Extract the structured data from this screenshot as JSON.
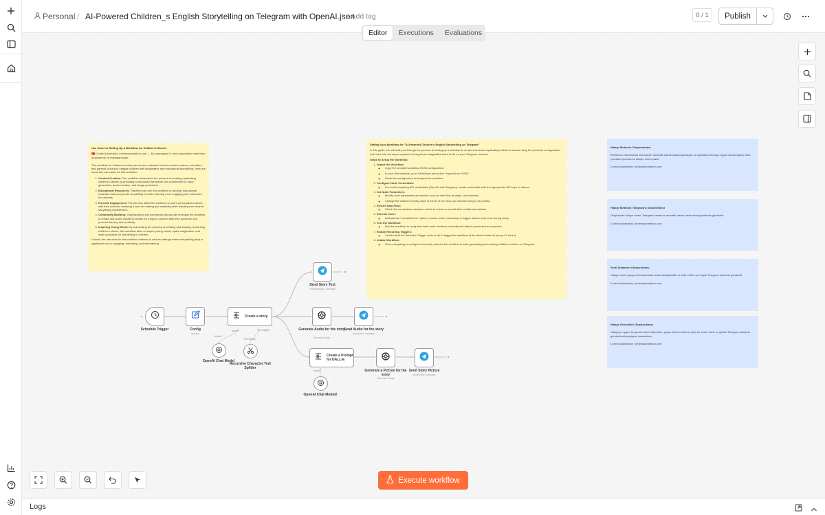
{
  "sidebar": {
    "items": [
      "add-icon",
      "search-icon",
      "panel-icon",
      "home-icon",
      "chart-icon",
      "help-icon",
      "settings-icon"
    ]
  },
  "header": {
    "project": "Personal",
    "separator": "/",
    "title": "AI-Powered Children_s English Storytelling on Telegram with OpenAI.json",
    "add_tag": "+ Add tag",
    "counter": "0 / 1",
    "publish": "Publish"
  },
  "tabs": {
    "editor": "Editor",
    "executions": "Executions",
    "evaluations": "Evaluations"
  },
  "notes": {
    "use_case": {
      "title": "Use Case for Setting Up a Workflow for Children's Stories",
      "brand_line": "🇹🇷 D-mim Automation | dmimautomation.com — Bu otomasyon D-mim Automation tarafından hazırlanmış ve markalanmıştır.",
      "intro": "The workflow for children's stories serves as a valuable tool for content creators, educators, and parents looking to engage children with imaginative and educational storytelling. Here are some key use cases for this workflow:",
      "items": [
        {
          "label": "Content Creation:",
          "text": "The workflow streamlines the process of creating captivating children's stories by providing a structured framework and automation for story generation, audio creation, and image production."
        },
        {
          "label": "Educational Resources:",
          "text": "Teachers can use this workflow to develop educational materials that incorporate storytelling to make learning more engaging and interactive for students."
        },
        {
          "label": "Parental Engagement:",
          "text": "Parents can utilize the workflow to share personalized stories with their children, fostering a love for reading and creativity while bonding over shared storytelling experiences."
        },
        {
          "label": "Community Building:",
          "text": "Organizations and community groups can leverage the workflow to create and share children's stories as a way to connect with their audience and promote literacy and creativity."
        },
        {
          "label": "Inspiring Young Minds:",
          "text": "By automating the process of creating and sharing enchanting children's stories, this workflow aims to inspire young minds, spark imagination, and instill a passion for storytelling in children."
        }
      ],
      "outro": "Overall, the use case for this workflow extends to various settings where storytelling plays a significant role in engaging, educating, and entertaining"
    },
    "setup": {
      "title": "Setting Up a Workflow for \"AI-Powered Children's English Storytelling on Telegram\"",
      "intro": "In this guide, we will walk you through the process of setting up a workflow to create and share captivating children's stories using the provided configuration. Let's dive into the steps required to bring these imaginative tales to life on your Telegram channel.",
      "steps_title": "Steps to Setup the Workflow:",
      "steps": [
        {
          "label": "Import the Workflow:",
          "bullets": [
            "Copy the provided workflow JSON configuration.",
            "In your n8n instance, go to Workflows and select \"Import from JSON.\"",
            "Paste the configuration and import the workflow."
          ]
        },
        {
          "label": "Configure Node Credentials:",
          "bullets": [
            "For nodes requiring API credentials (OpenAI and Telegram), create credentials with the appropriate API keys or tokens."
          ]
        },
        {
          "label": "Set Node Parameters:",
          "bullets": [
            "Modify node parameters as needed, such as chat IDs, prompts, and intervals.",
            "Change the chatId in Config node to the ID of the chat you want the story to be posted."
          ]
        },
        {
          "label": "Ensure Data Flow:",
          "bullets": [
            "Check the connections between nodes to ensure a smooth flow of data and actions."
          ]
        },
        {
          "label": "Execute Once:",
          "bullets": [
            "Activate the \"executeOnce\" option in nodes where necessary to trigger actions only once during setup."
          ]
        },
        {
          "label": "Test the Workflow:",
          "bullets": [
            "Run the workflow to verify that each node functions correctly and data is processed as expected."
          ]
        },
        {
          "label": "Enable Recurring Triggers:",
          "bullets": [
            "Confirm that the Schedule Trigger node is set to trigger the workflow at the desired interval (every 12 hours)."
          ]
        },
        {
          "label": "Initiate Workflow:",
          "bullets": [
            "Once everything is configured correctly, activate the workflow to start generating and sharing children's stories on Telegram."
          ]
        }
      ]
    },
    "blue1": {
      "title": "Hikaye Metninin Oluşturulması",
      "body": "Belirlenen zamanlarda otomasyon otomatik olarak çalışmaya başlar ve ayarlanan temaya uygun olarak yapay zeka çocuklar için kısa bir hikaye metni yazar.",
      "sig": "D-mim Automation | dmimautomation.com"
    },
    "blue2": {
      "title": "Hikaye Metninin Telegram'a Gönderilmesi",
      "body": "Oluşturulan hikaye metni, Telegram kanalına otomatik olarak metin mesajı şeklinde gönderilir.",
      "sig": "D-mim Automation | dmimautomation.com"
    },
    "blue3": {
      "title": "Sesli Anlatımın Oluşturulması",
      "body": "Hikaye metni yapay zeka tarafından sese dönüştürülür ve elde edilen ses kaydı Telegram kanalına gönderilir.",
      "sig": "D-mim Automation | dmimautomation.com"
    },
    "blue4": {
      "title": "Hikaye Görselinin Oluşturulması",
      "body": "Hikayeye uygun bir görsel isteml hazırlanır, yapay zeka bu isteme göre bir resim üretir ve görsel Telegram kanalına gönderilerek paylaşım tamamlanır.",
      "sig": "D-mim Automation | dmimautomation.com"
    }
  },
  "nodes": {
    "schedule": {
      "label": "Schedule Trigger"
    },
    "config": {
      "label": "Config",
      "sub": "manual"
    },
    "story": {
      "label": "Create a story"
    },
    "model1": {
      "label": "OpenAI Chat Model"
    },
    "splitter": {
      "label": "Recursive Character Text Splitter"
    },
    "send_text": {
      "label": "Send Story Text",
      "sub": "sendMessage: message"
    },
    "gen_audio": {
      "label": "Generate Audio for the story",
      "sub": "Generate Audio"
    },
    "send_audio": {
      "label": "Send Audio for the story",
      "sub": "sendAudio: message"
    },
    "prompt": {
      "label": "Create a Prompt for DALL-E"
    },
    "model2": {
      "label": "OpenAI Chat Model2"
    },
    "gen_pic": {
      "label": "Generate a Picture for the story",
      "sub": "Generate Image"
    },
    "send_pic": {
      "label": "Send Story Picture",
      "sub": "sendPhoto: message"
    }
  },
  "connectors": {
    "model": "Model*",
    "text_splitter": "Text Splitter",
    "model_alt": "Model*"
  },
  "execute": "Execute workflow",
  "logs": "Logs",
  "colors": {
    "accent": "#ff6d3a",
    "note_yellow": "#fff5bf",
    "note_blue": "#d9e6ff",
    "telegram": "#2aa4e0"
  }
}
